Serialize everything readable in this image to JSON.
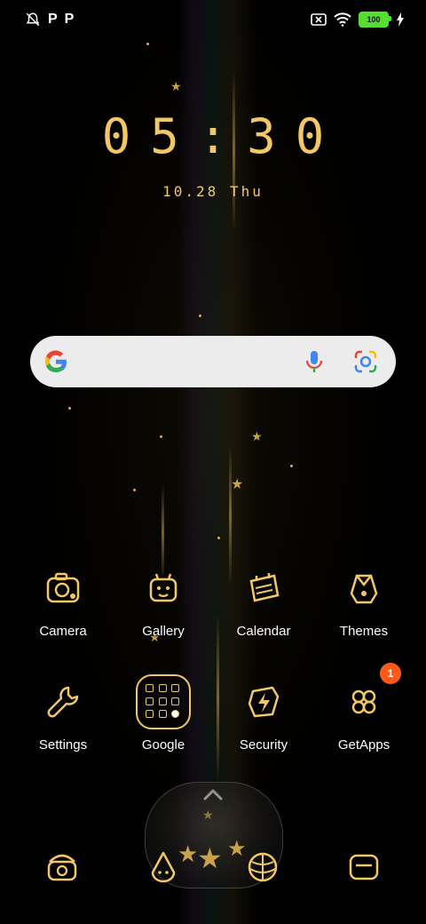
{
  "status_bar": {
    "left_icons": [
      "notifications-off-icon",
      "p-icon",
      "p-icon"
    ],
    "p_left": "P",
    "p_right": "P",
    "right_icons": [
      "sim-off-icon",
      "wifi-icon",
      "battery-icon",
      "charging-icon"
    ],
    "battery_level": "100"
  },
  "clock": {
    "time": "05:30",
    "date": "10.28 Thu"
  },
  "search_bar": {
    "icons": [
      "google-g-icon",
      "microphone-icon",
      "google-lens-icon"
    ]
  },
  "apps": {
    "row1": [
      {
        "label": "Camera",
        "icon": "camera-icon"
      },
      {
        "label": "Gallery",
        "icon": "gallery-icon"
      },
      {
        "label": "Calendar",
        "icon": "calendar-icon"
      },
      {
        "label": "Themes",
        "icon": "themes-icon"
      }
    ],
    "row2": [
      {
        "label": "Settings",
        "icon": "wrench-icon"
      },
      {
        "label": "Google",
        "icon": "folder-icon"
      },
      {
        "label": "Security",
        "icon": "shield-icon"
      },
      {
        "label": "GetApps",
        "icon": "flower-icon",
        "badge": "1"
      }
    ]
  },
  "dock": {
    "icons": [
      "phone-icon",
      "messages-icon",
      "browser-icon",
      "notes-icon"
    ]
  },
  "colors": {
    "accent": "#f2c766",
    "badge": "#ff5a1a",
    "battery": "#55dd33",
    "search_bg": "#ececec"
  }
}
